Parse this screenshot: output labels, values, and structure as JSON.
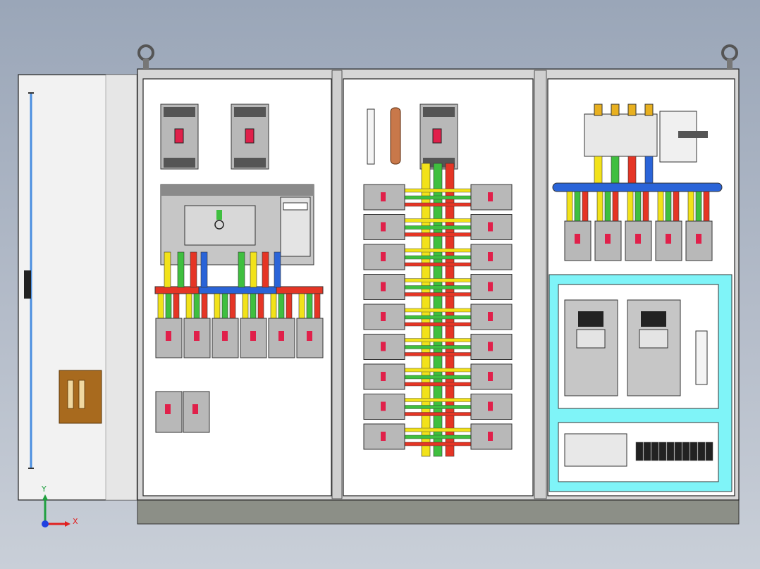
{
  "colors": {
    "phase_yellow": "#f2e21a",
    "phase_green": "#3fbf3f",
    "phase_red": "#e53525",
    "neutral_blue": "#2a64d8",
    "cyan_frame": "#7ff4f8",
    "copper": "#c8784a",
    "breaker_grey": "#b8b8b8",
    "breaker_dark": "#555555",
    "handle_red": "#e0204a",
    "door_blue_rod": "#4a8ee0",
    "handle_brown": "#a86a1e",
    "base_plinth": "#8c8f87",
    "axis_x": "#e02020",
    "axis_y": "#20a040",
    "axis_z": "#2040e0"
  },
  "axis": {
    "x_label": "X",
    "y_label": "Y"
  }
}
